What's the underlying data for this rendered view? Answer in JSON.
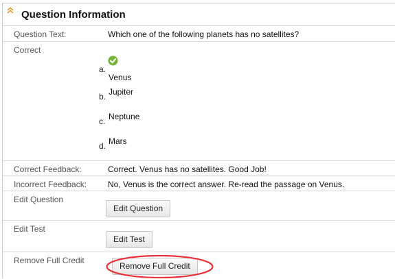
{
  "header": {
    "title": "Question Information",
    "collapse_icon": "double-chevron-up-icon"
  },
  "question": {
    "label": "Question Text:",
    "text": "Which one of the following planets has no satellites?"
  },
  "correct": {
    "label": "Correct",
    "answers": [
      {
        "letter": "a.",
        "text": "Venus",
        "is_correct": true,
        "icon": "check-circle-icon"
      },
      {
        "letter": "b.",
        "text": "Jupiter",
        "is_correct": false
      },
      {
        "letter": "c.",
        "text": "Neptune",
        "is_correct": false
      },
      {
        "letter": "d.",
        "text": "Mars",
        "is_correct": false
      }
    ]
  },
  "feedback": {
    "correct_label": "Correct Feedback:",
    "correct_text": "Correct. Venus has no satellites. Good Job!",
    "incorrect_label": "Incorrect Feedback:",
    "incorrect_text": "No, Venus is the correct answer. Re-read the passage on Venus."
  },
  "actions": {
    "edit_question_label": "Edit Question",
    "edit_question_button": "Edit Question",
    "edit_test_label": "Edit Test",
    "edit_test_button": "Edit Test",
    "remove_credit_label": "Remove Full Credit",
    "remove_credit_button": "Remove Full Credit"
  },
  "colors": {
    "check": "#7ab33b",
    "highlight": "#e8333a",
    "header_chevron": "#e8a33a"
  }
}
